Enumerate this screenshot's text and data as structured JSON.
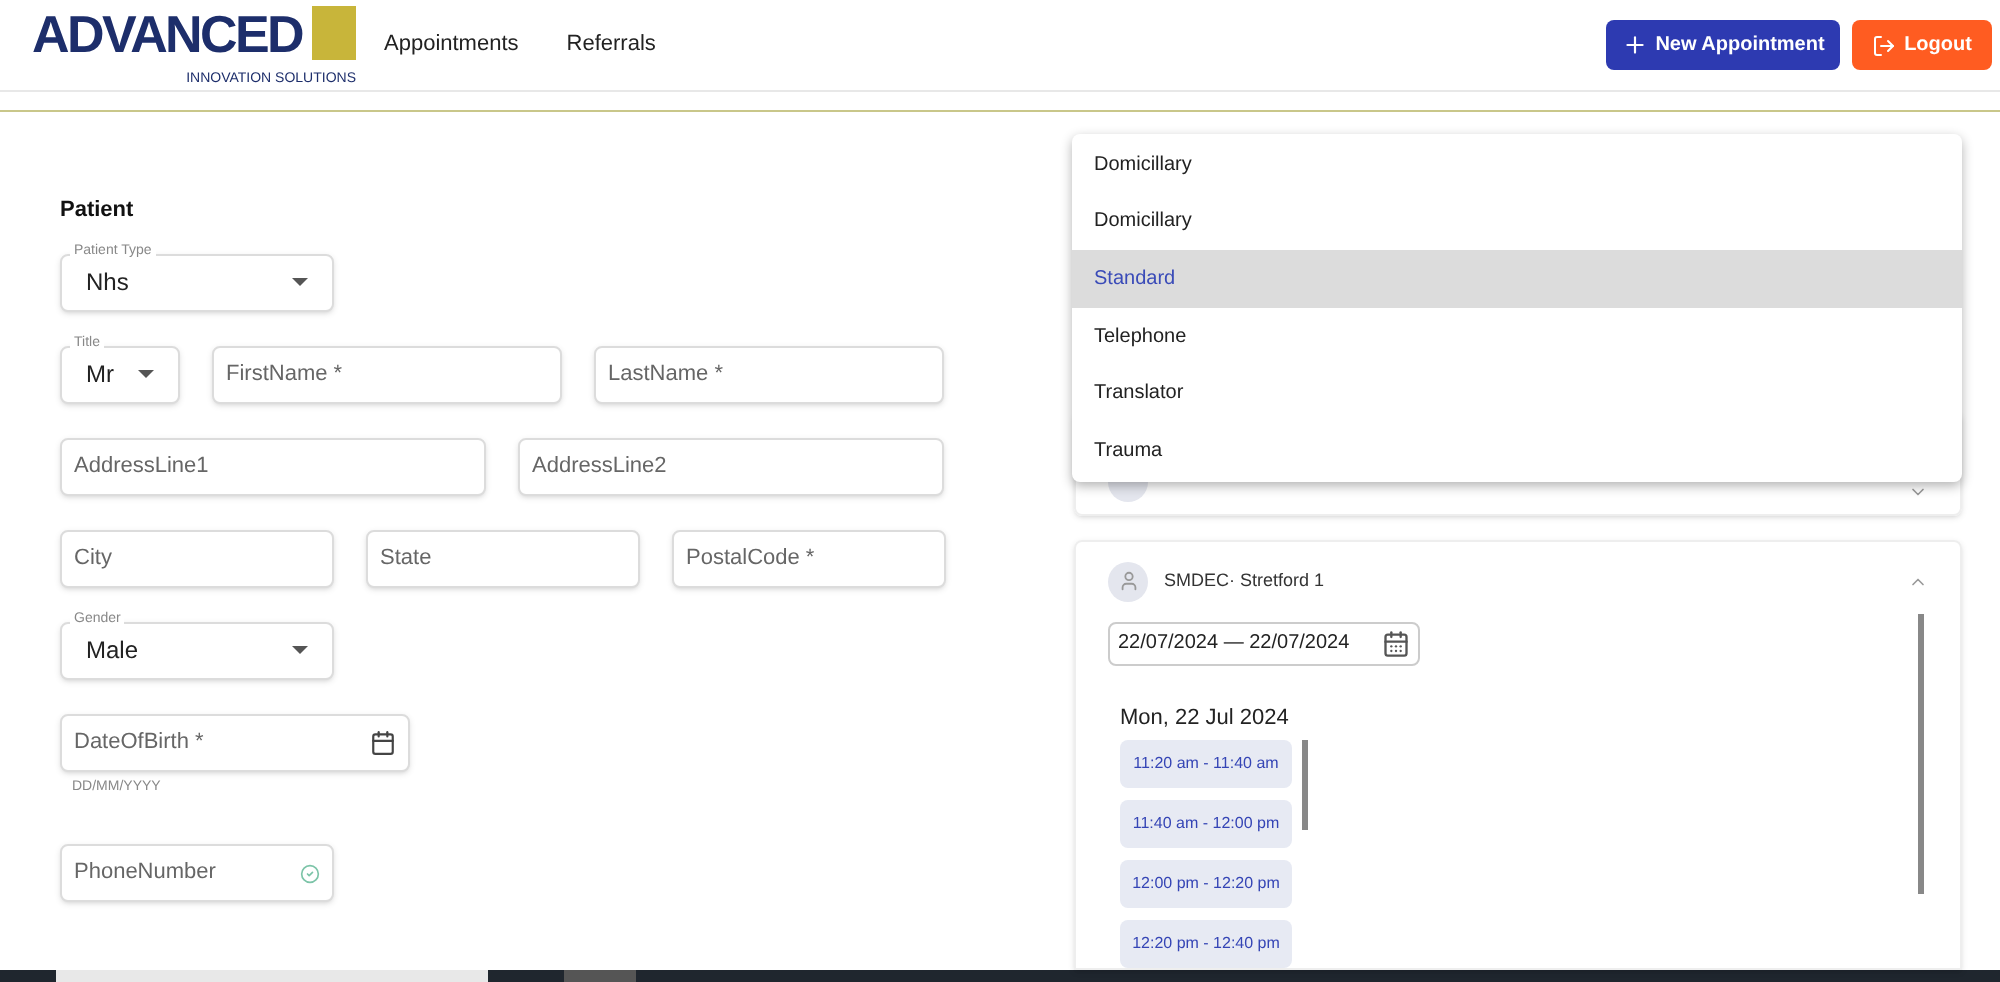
{
  "header": {
    "logo": {
      "word": "ADVANCED",
      "tagline": "INNOVATION SOLUTIONS"
    },
    "nav": [
      {
        "label": "Appointments"
      },
      {
        "label": "Referrals"
      }
    ],
    "new_button": "New Appointment",
    "logout_button": "Logout"
  },
  "patient": {
    "title": "Patient",
    "rows": [
      [
        {
          "kind": "select",
          "label": "Patient Type",
          "value": "Nhs"
        }
      ],
      [
        {
          "kind": "select",
          "label": "Title",
          "value": "Mr"
        },
        {
          "kind": "text",
          "placeholder": "FirstName *"
        },
        {
          "kind": "text",
          "placeholder": "LastName *"
        }
      ],
      [
        {
          "kind": "text",
          "placeholder": "AddressLine1"
        },
        {
          "kind": "text",
          "placeholder": "AddressLine2"
        }
      ],
      [
        {
          "kind": "text",
          "placeholder": "City"
        },
        {
          "kind": "text",
          "placeholder": "State"
        },
        {
          "kind": "text",
          "placeholder": "PostalCode *"
        }
      ],
      [
        {
          "kind": "select",
          "label": "Gender",
          "value": "Male"
        }
      ],
      [
        {
          "kind": "date",
          "placeholder": "DateOfBirth *",
          "helper": "DD/MM/YYYY"
        }
      ],
      [
        {
          "kind": "phone",
          "placeholder": "PhoneNumber"
        }
      ]
    ]
  },
  "menu": [
    {
      "label": "Domicillary",
      "selected": false
    },
    {
      "label": "Domicillary",
      "selected": false
    },
    {
      "label": "Standard",
      "selected": true
    },
    {
      "label": "Telephone",
      "selected": false
    },
    {
      "label": "Translator",
      "selected": false
    },
    {
      "label": "Trauma",
      "selected": false
    }
  ],
  "clinics": [
    {
      "name": "SMDEC· Stretford 1",
      "expanded": true,
      "date_range": "22/07/2024 — 22/07/2024",
      "day": "Mon, 22 Jul 2024",
      "slots": [
        "11:20 am - 11:40 am",
        "11:40 am - 12:00 pm",
        "12:00 pm - 12:20 pm",
        "12:20 pm - 12:40 pm"
      ]
    }
  ]
}
